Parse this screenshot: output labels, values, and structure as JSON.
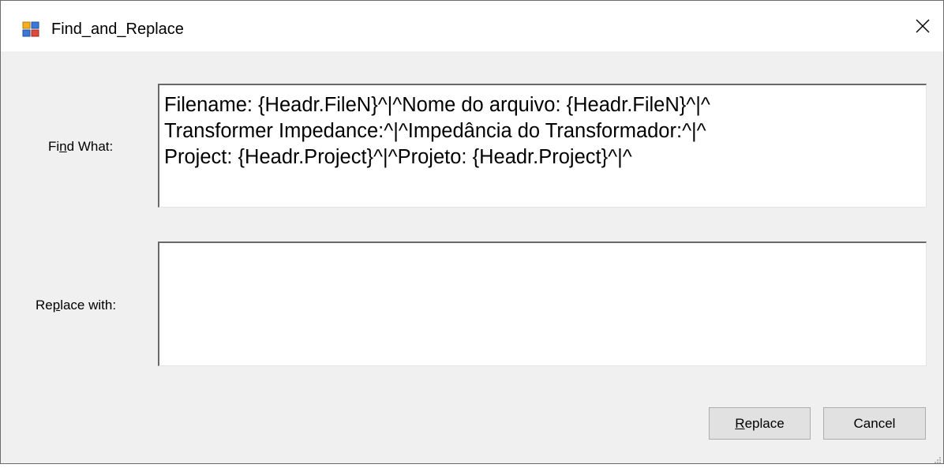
{
  "window": {
    "title": "Find_and_Replace",
    "app_icon": "form-window-icon",
    "close_icon": "close-icon",
    "close_glyph": "✕"
  },
  "find": {
    "label_pre": "Fi",
    "label_accel": "n",
    "label_post": "d What:",
    "value": "Filename: {Headr.FileN}^|^Nome do arquivo: {Headr.FileN}^|^\nTransformer Impedance:^|^Impedância do Transformador:^|^\nProject: {Headr.Project}^|^Projeto: {Headr.Project}^|^"
  },
  "replace": {
    "label_pre": "Re",
    "label_accel": "p",
    "label_post": "lace with:",
    "value": ""
  },
  "buttons": {
    "replace_accel": "R",
    "replace_rest": "eplace",
    "cancel_label": "Cancel"
  },
  "colors": {
    "window_bg": "#f0f0f0",
    "titlebar_bg": "#ffffff",
    "button_bg": "#e1e1e1",
    "button_border": "#adadad"
  }
}
